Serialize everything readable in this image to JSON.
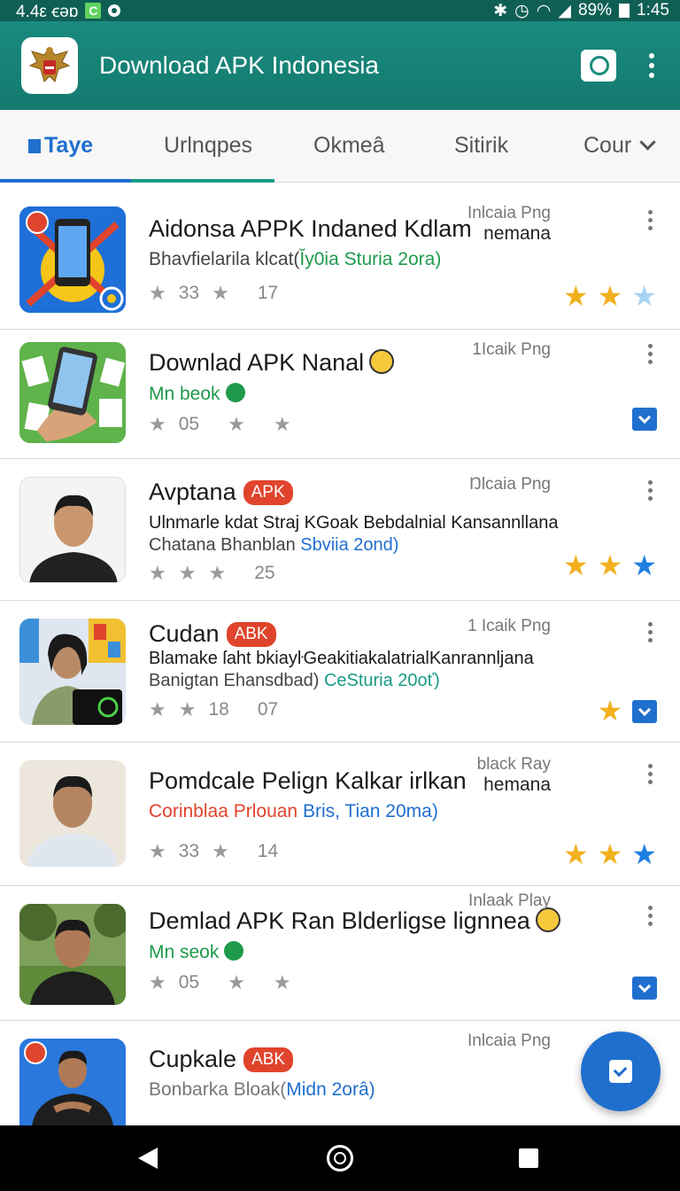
{
  "status": {
    "left_text": "4.4ε ꞓǝɒ",
    "battery": "89%",
    "time": "1:45"
  },
  "appbar": {
    "title": "Download APK Indonesia"
  },
  "tabs": [
    {
      "label": "Taye",
      "active": true
    },
    {
      "label": "Urlnqpes",
      "active": false
    },
    {
      "label": "Okmeâ",
      "active": false
    },
    {
      "label": "Sitirik",
      "active": false
    },
    {
      "label": "Cour",
      "active": false
    }
  ],
  "items": [
    {
      "title": "Aidonsa APPK Indaned Kdlam",
      "source": "Inlcaia Png",
      "source2": "nemana",
      "sub_a": "Bhavfielarila klcat(",
      "sub_b": "Ĭy0ia Sturia 2ora)",
      "meta_a": "33",
      "meta_b": "17",
      "rating": [
        "y",
        "y",
        "lb"
      ]
    },
    {
      "title": "Downlad APK Nanal",
      "source": "1Icaik Png",
      "sub_a": "Mn beok",
      "meta_a": "05",
      "rating": [
        "check"
      ]
    },
    {
      "title": "Avptana",
      "badge": "APK",
      "source": "Ŋlcaia Png",
      "desc": "Ulnmarle kdat Straj KGoak Bebdalnial Kansannllana",
      "sub_a": "Chatana Bhanblan ",
      "sub_b": "Sbviia 2ond)",
      "meta_b": "25",
      "rating": [
        "y",
        "y",
        "b"
      ]
    },
    {
      "title": "Cudan",
      "badge": "ABK",
      "source": "1 Icaik Png",
      "desc": "Blamake ſaht bkiayŀGeakitiakalatrialKanrannljana",
      "sub_a": "Banigtan Ehansdbad) ",
      "sub_b": "CeSturia 20oť)",
      "meta_a": "18",
      "meta_b": "07",
      "rating": [
        "y",
        "y",
        "check"
      ]
    },
    {
      "title": "Pomdcale Pelign Kalkar irlkan",
      "source": "black Ray",
      "source2": "hemana",
      "sub_a": "Corinblaa Prlouan ",
      "sub_b": "Bris, Tian 20ma)",
      "meta_a": "33",
      "meta_b": "14",
      "rating": [
        "y",
        "y",
        "b"
      ]
    },
    {
      "title": "Demlad APK Ran Blderligse lignnea",
      "source": "Inlaak Play",
      "sub_a": "Mn seok",
      "meta_a": "05",
      "rating": [
        "check"
      ]
    },
    {
      "title": "Cupkale",
      "badge": "ABK",
      "source": "Inlcaia Png",
      "sub_a": "Bonbarka Bloak(",
      "sub_b": "Midn 2orâ)"
    }
  ]
}
